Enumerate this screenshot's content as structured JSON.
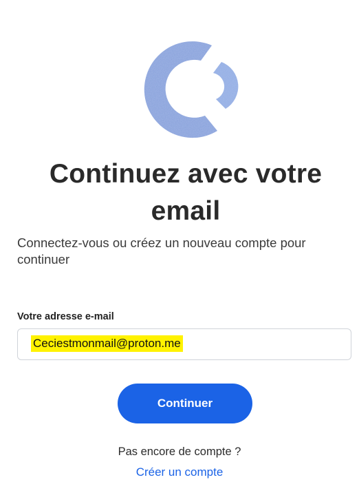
{
  "logo": {
    "icon": "brand-c-logo-icon",
    "color": "#7f9ad6"
  },
  "heading": {
    "title": "Continuez avec votre email"
  },
  "subheading": "Connectez-vous ou créez un nouveau compte pour continuer",
  "form": {
    "email_label": "Votre adresse e-mail",
    "email_value": "Ceciestmonmail@proton.me",
    "highlight_color": "#fff200",
    "submit_label": "Continuer",
    "submit_color": "#1b63e6"
  },
  "footer": {
    "no_account_text": "Pas encore de compte ?",
    "create_account_link": "Créer un compte"
  }
}
